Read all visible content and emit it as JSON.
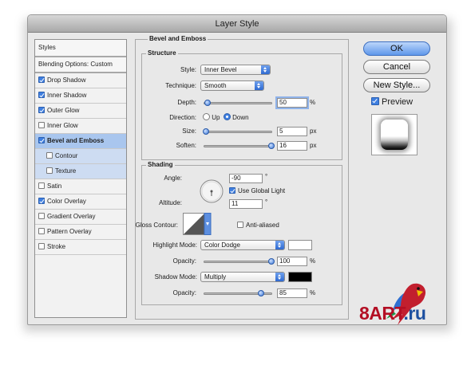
{
  "window": {
    "title": "Layer Style"
  },
  "sidebar": {
    "styles_label": "Styles",
    "blending_label": "Blending Options: Custom",
    "items": [
      {
        "label": "Drop Shadow",
        "checked": true
      },
      {
        "label": "Inner Shadow",
        "checked": true
      },
      {
        "label": "Outer Glow",
        "checked": true
      },
      {
        "label": "Inner Glow",
        "checked": false
      },
      {
        "label": "Bevel and Emboss",
        "checked": true
      },
      {
        "label": "Contour",
        "checked": false
      },
      {
        "label": "Texture",
        "checked": false
      },
      {
        "label": "Satin",
        "checked": false
      },
      {
        "label": "Color Overlay",
        "checked": true
      },
      {
        "label": "Gradient Overlay",
        "checked": false
      },
      {
        "label": "Pattern Overlay",
        "checked": false
      },
      {
        "label": "Stroke",
        "checked": false
      }
    ]
  },
  "bevel": {
    "title": "Bevel and Emboss",
    "structure": {
      "title": "Structure",
      "style_label": "Style:",
      "style_value": "Inner Bevel",
      "technique_label": "Technique:",
      "technique_value": "Smooth",
      "depth_label": "Depth:",
      "depth_value": "50",
      "depth_unit": "%",
      "depth_fraction": 0.05,
      "direction_label": "Direction:",
      "direction_up": "Up",
      "direction_down": "Down",
      "size_label": "Size:",
      "size_value": "5",
      "size_unit": "px",
      "size_fraction": 0.02,
      "soften_label": "Soften:",
      "soften_value": "16",
      "soften_unit": "px",
      "soften_fraction": 1.0
    },
    "shading": {
      "title": "Shading",
      "angle_label": "Angle:",
      "angle_value": "-90",
      "degree_sign": "°",
      "global_light_label": "Use Global Light",
      "altitude_label": "Altitude:",
      "altitude_value": "11",
      "gloss_label": "Gloss Contour:",
      "anti_alias_label": "Anti-aliased",
      "highlight_mode_label": "Highlight Mode:",
      "highlight_mode_value": "Color Dodge",
      "highlight_color": "#ffffff",
      "highlight_opacity_label": "Opacity:",
      "highlight_opacity_value": "100",
      "highlight_opacity_fraction": 1.0,
      "shadow_mode_label": "Shadow Mode:",
      "shadow_mode_value": "Multiply",
      "shadow_color": "#000000",
      "shadow_opacity_label": "Opacity:",
      "shadow_opacity_value": "85",
      "shadow_opacity_fraction": 0.85,
      "percent": "%"
    }
  },
  "buttons": {
    "ok": "OK",
    "cancel": "Cancel",
    "new_style": "New Style...",
    "preview": "Preview"
  },
  "watermark": {
    "main": "8ART",
    "suffix": ".ru"
  }
}
